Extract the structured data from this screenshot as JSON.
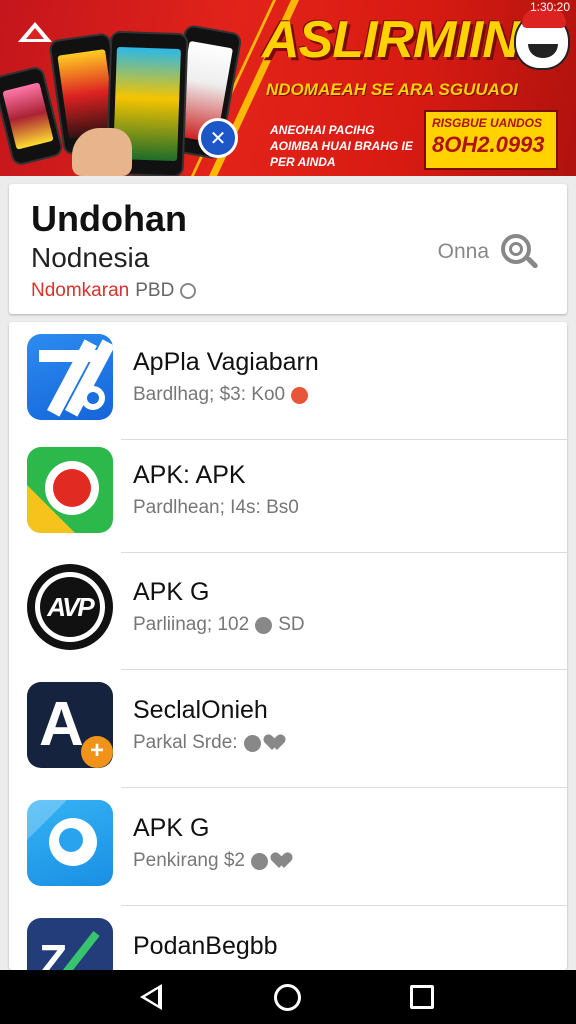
{
  "status_bar": {
    "time": "1:30:20"
  },
  "banner": {
    "title": "ASLIRMIIN",
    "subtitle": "NDOMAEAH SE ARA SGUUAOI",
    "description": "ANEOHAI PACIHG AOIMBA HUAI BRAHG IE PER AINDA",
    "promo_line1": "RISGBUE UANDOS",
    "promo_line2": "8OH2.0993"
  },
  "header": {
    "title": "Undohan",
    "subtitle": "Nodnesia",
    "meta_red": "Ndomkaran",
    "meta_grey": "PBD",
    "action_label": "Onna"
  },
  "apps": [
    {
      "title": "ApPla Vagiabarn",
      "meta": "Bardlhag; $3: Ko0",
      "icon": "slash-app-icon"
    },
    {
      "title": "APK: APK",
      "meta": "Pardlhean; I4s: Bs0",
      "icon": "red-dot-app-icon"
    },
    {
      "title": "APK G",
      "meta": "Parliinag; 102",
      "meta_tail": "SD",
      "icon": "avp-logo-icon"
    },
    {
      "title": "SeclalOnieh",
      "meta": "Parkal Srde:",
      "icon": "a-plus-app-icon"
    },
    {
      "title": "APK G",
      "meta": "Penkirang $2",
      "icon": "phone-app-icon"
    },
    {
      "title": "PodanBegbb",
      "meta": "",
      "icon": "pen-app-icon"
    }
  ],
  "ic_text": {
    "avp": "AVP",
    "a": "A",
    "plus": "+",
    "z": "Z"
  }
}
